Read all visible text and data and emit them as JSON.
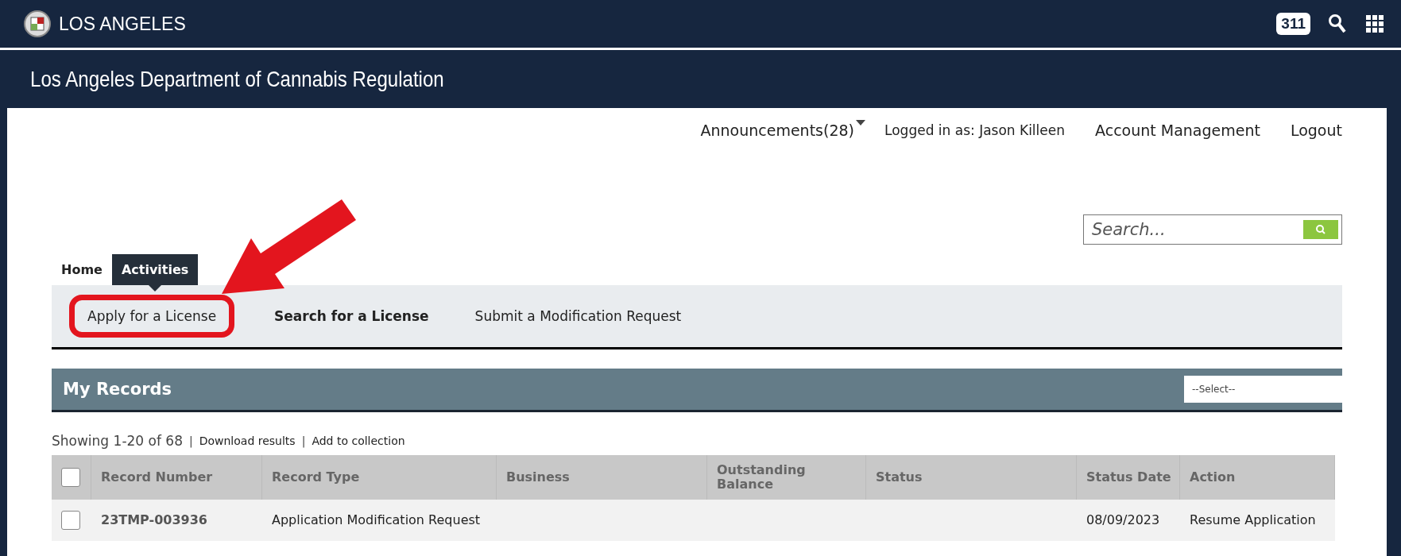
{
  "top_bar": {
    "city": "LOS ANGELES",
    "badge": "311"
  },
  "header": {
    "title": "Los Angeles Department of Cannabis Regulation"
  },
  "user_links": [
    {
      "label": "Announcements(28)",
      "kind": "dropdown"
    },
    {
      "label": "Logged in as: Jason Killeen",
      "kind": "text"
    },
    {
      "label": "Account Management",
      "kind": "link"
    },
    {
      "label": "Logout",
      "kind": "link"
    }
  ],
  "search": {
    "placeholder": "Search..."
  },
  "tabs": [
    {
      "label": "Home",
      "selected": false
    },
    {
      "label": "Activities",
      "selected": true
    }
  ],
  "subnav": [
    {
      "label": "Apply for a License",
      "highlighted": true,
      "bold": false
    },
    {
      "label": "Search for a License",
      "highlighted": false,
      "bold": true
    },
    {
      "label": "Submit a Modification Request",
      "highlighted": false,
      "bold": false
    }
  ],
  "records": {
    "title": "My Records",
    "select": "--Select--",
    "summary": "Showing 1-20 of 68",
    "separator": "|",
    "actions": [
      "Download results",
      "Add to collection"
    ],
    "columns": [
      "Record Number",
      "Record Type",
      "Business",
      "Outstanding Balance",
      "Status",
      "Status Date",
      "Action"
    ],
    "header_checked": false,
    "rows": [
      {
        "checked": false,
        "cells": [
          "23TMP-003936",
          "Application Modification Request",
          "",
          "",
          "",
          "08/09/2023",
          "Resume Application"
        ]
      }
    ]
  }
}
